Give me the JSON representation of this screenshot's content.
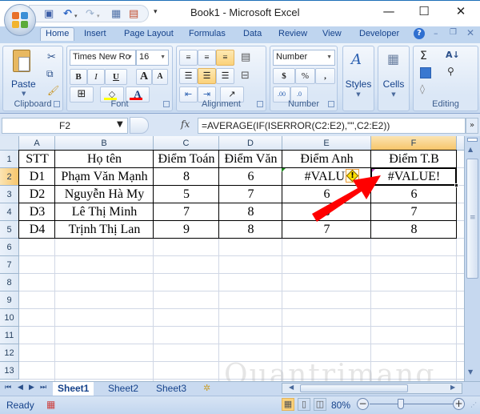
{
  "window": {
    "title": "Book1 - Microsoft Excel",
    "controls": {
      "minimize": "—",
      "maximize": "☐",
      "close": "✕"
    }
  },
  "quick_access": [
    {
      "name": "save-icon",
      "glyph": "💾"
    },
    {
      "name": "undo-icon",
      "glyph": "↶"
    },
    {
      "name": "redo-icon",
      "glyph": "↷"
    },
    {
      "name": "calculator-icon",
      "glyph": "▦"
    },
    {
      "name": "form-icon",
      "glyph": "▤"
    },
    {
      "name": "customize-icon",
      "glyph": "▾"
    }
  ],
  "ribbon_tabs": [
    "Home",
    "Insert",
    "Page Layout",
    "Formulas",
    "Data",
    "Review",
    "View",
    "Developer"
  ],
  "active_tab": "Home",
  "ribbon": {
    "clipboard": {
      "label": "Clipboard",
      "paste": "Paste"
    },
    "font": {
      "label": "Font",
      "font_name": "Times New Ro",
      "font_size": "16",
      "bold": "B",
      "italic": "I",
      "underline": "U",
      "grow": "A",
      "shrink": "A",
      "fill_color": "#ffff00",
      "font_color": "#ff0000"
    },
    "alignment": {
      "label": "Alignment"
    },
    "number": {
      "label": "Number",
      "format": "Number",
      "currency": "$",
      "percent": "%",
      "comma": ",",
      "inc_decimal": ".0→.00",
      "dec_decimal": ".00→.0"
    },
    "styles": {
      "label": "Styles"
    },
    "cells": {
      "label": "Cells"
    },
    "editing": {
      "label": "Editing",
      "sum": "Σ"
    }
  },
  "formula_bar": {
    "name_box": "F2",
    "fx": "fx",
    "formula": "=AVERAGE(IF(ISERROR(C2:E2),\"\",C2:E2))"
  },
  "sheet": {
    "columns": [
      "A",
      "B",
      "C",
      "D",
      "E",
      "F"
    ],
    "selected_column": "F",
    "selected_row": "2",
    "rows": [
      "1",
      "2",
      "3",
      "4",
      "5",
      "6",
      "7",
      "8",
      "9",
      "10",
      "11",
      "12",
      "13"
    ],
    "headers": [
      "STT",
      "Họ tên",
      "Điểm Toán",
      "Điểm Văn",
      "Điểm Anh",
      "Điểm T.B"
    ],
    "data": [
      [
        "D1",
        "Phạm Văn Mạnh",
        "8",
        "6",
        "#VALUE!",
        "#VALUE!"
      ],
      [
        "D2",
        "Nguyễn Hà My",
        "5",
        "7",
        "6",
        "6"
      ],
      [
        "D3",
        "Lê Thị Minh",
        "7",
        "8",
        "8",
        "7"
      ],
      [
        "D4",
        "Trịnh Thị Lan",
        "9",
        "8",
        "7",
        "8"
      ]
    ],
    "e2_visible": "#VALUI",
    "active_cell": "F2"
  },
  "sheet_tabs": [
    "Sheet1",
    "Sheet2",
    "Sheet3"
  ],
  "active_sheet": "Sheet1",
  "status": {
    "text": "Ready",
    "zoom": "80%"
  },
  "annotation": {
    "color": "#ff0000"
  },
  "watermark": "Quantrimang"
}
